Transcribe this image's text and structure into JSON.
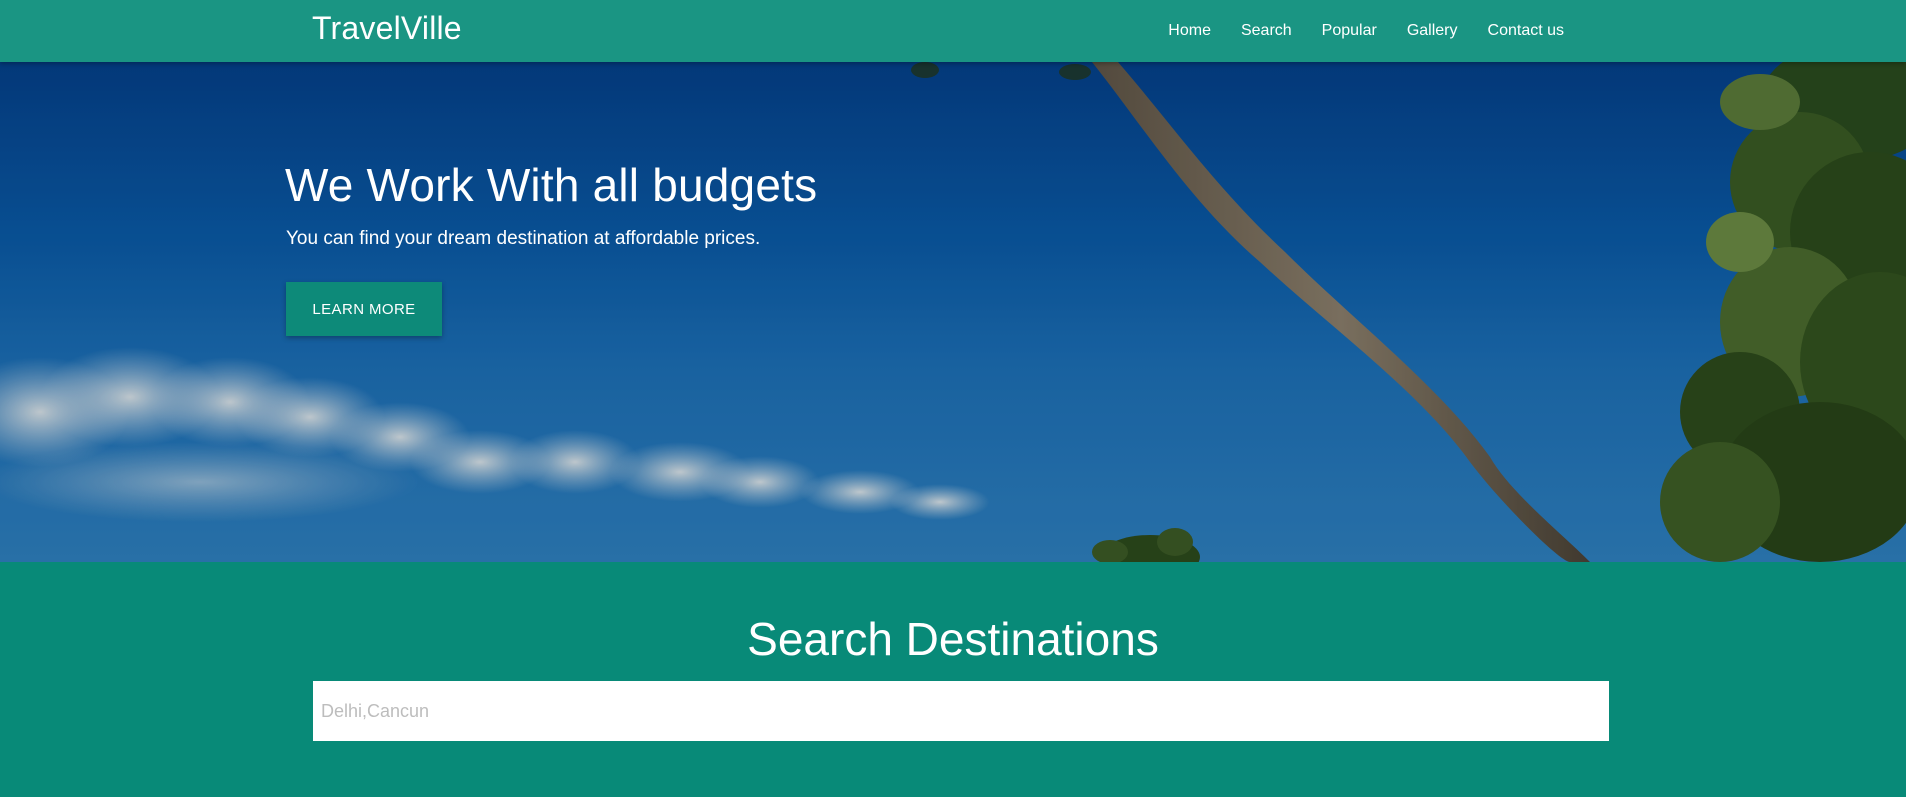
{
  "brand": "TravelVille",
  "nav": {
    "items": [
      {
        "label": "Home"
      },
      {
        "label": "Search"
      },
      {
        "label": "Popular"
      },
      {
        "label": "Gallery"
      },
      {
        "label": "Contact us"
      }
    ]
  },
  "hero": {
    "title": "We Work With all budgets",
    "subtitle": "You can find your dream destination at affordable prices.",
    "button_label": "LEARN MORE"
  },
  "search": {
    "title": "Search Destinations",
    "placeholder": "Delhi,Cancun",
    "value": ""
  },
  "colors": {
    "navbar": "#1a9583",
    "accent": "#0d8a79",
    "search_section": "#088a78"
  }
}
